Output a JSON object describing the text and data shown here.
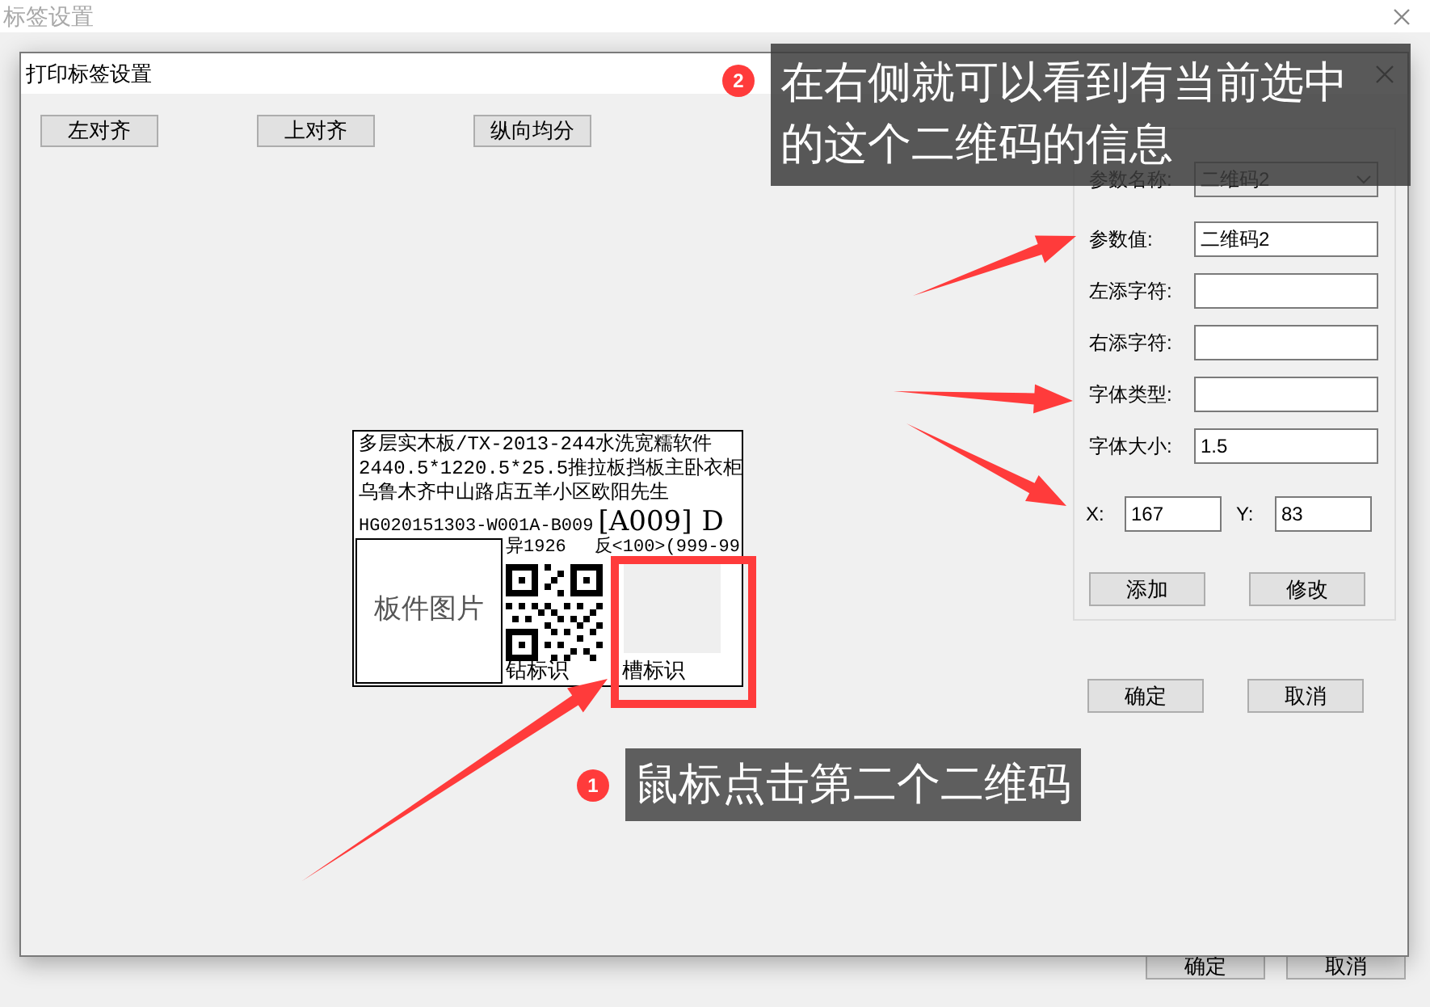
{
  "background_window": {
    "title": "标签设置",
    "buttons": [
      "确定",
      "取消"
    ]
  },
  "dialog": {
    "title": "打印标签设置",
    "toolbar": [
      "左对齐",
      "上对齐",
      "纵向均分"
    ],
    "label_preview": {
      "lines": [
        "多层实木板/TX-2013-244水洗宽糯软件",
        "2440.5*1220.5*25.5推拉板挡板主卧衣柜",
        "乌鲁木齐中山路店五羊小区欧阳先生"
      ],
      "code": "HG020151303-W001A-B009",
      "tag": "[A009]",
      "suffix": "D",
      "image_label": "板件图片",
      "row_left": "异1926",
      "row_right": "反<100>(999-99",
      "marks": [
        "钻标识",
        "槽标识"
      ]
    },
    "params": {
      "fields": [
        {
          "label": "参数名称:",
          "value": "二维码2",
          "kind": "dropdown"
        },
        {
          "label": "参数值:",
          "value": "二维码2",
          "kind": "text"
        },
        {
          "label": "左添字符:",
          "kind": "text"
        },
        {
          "label": "右添字符:",
          "kind": "text"
        },
        {
          "label": "字体类型:",
          "kind": "text"
        },
        {
          "label": "字体大小:",
          "value": "1.5",
          "kind": "text"
        }
      ],
      "x": {
        "label": "X:",
        "value": "167"
      },
      "y": {
        "label": "Y:",
        "value": "83"
      },
      "buttons": [
        "添加",
        "修改"
      ]
    },
    "buttons": [
      "确定",
      "取消"
    ]
  },
  "callouts": [
    {
      "number": "1",
      "text": "鼠标点击第二个二维码"
    },
    {
      "number": "2",
      "text": "在右侧就可以看到有当前选中的这个二维码的信息"
    }
  ]
}
